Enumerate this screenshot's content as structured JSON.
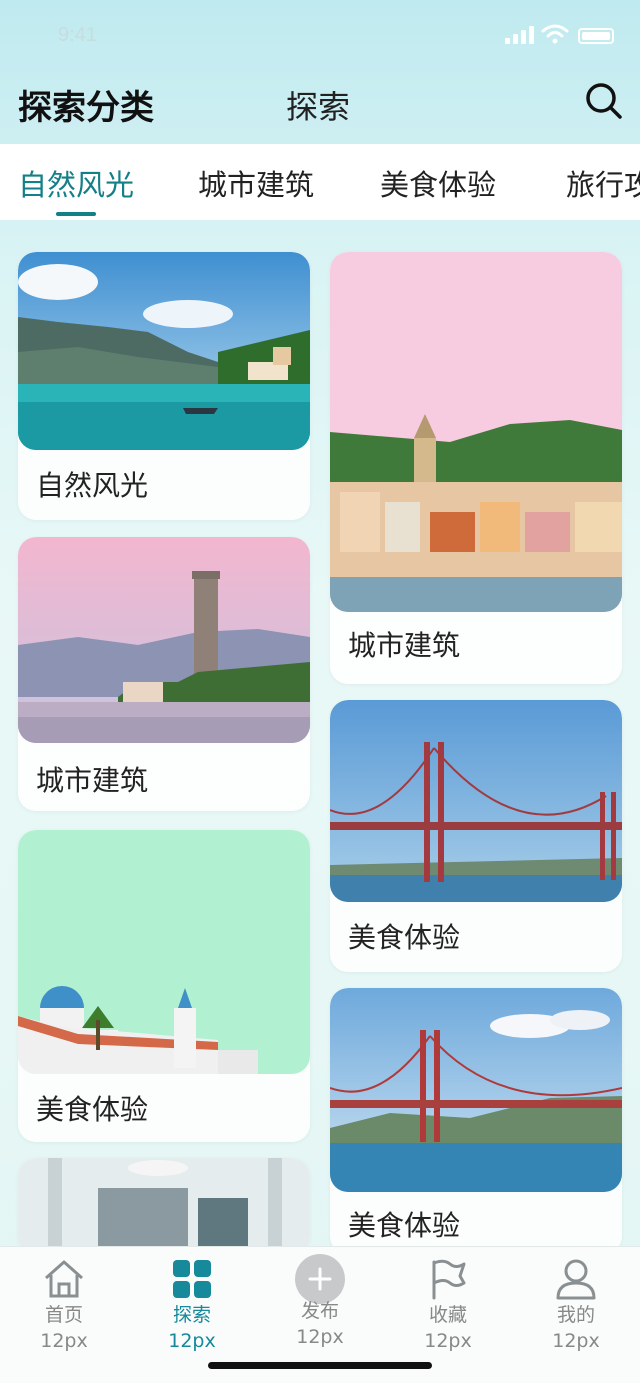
{
  "status_bar": {
    "time": "9:41"
  },
  "header": {
    "title": "探索分类",
    "subtitle": "探索"
  },
  "tabs": [
    {
      "label": "自然风光",
      "active": true
    },
    {
      "label": "城市建筑",
      "active": false
    },
    {
      "label": "美食体验",
      "active": false
    },
    {
      "label": "旅行攻略",
      "active": false
    }
  ],
  "cards": [
    {
      "label": "自然风光",
      "image": "seaside-village-with-boat"
    },
    {
      "label": "城市建筑",
      "image": "colorful-harbor-town-with-bell-tower"
    },
    {
      "label": "城市建筑",
      "image": "stone-tower-by-lake-at-dusk"
    },
    {
      "label": "美食体验",
      "image": "suspension-bridge-blue-sky"
    },
    {
      "label": "美食体验",
      "image": "white-church-with-blue-dome"
    },
    {
      "label": "美食体验",
      "image": "suspension-bridge-over-bay"
    },
    {
      "label": "",
      "image": "interior-hall-with-chandelier"
    }
  ],
  "bottom_nav": [
    {
      "label": "首页",
      "size": "12px",
      "icon": "home-icon",
      "active": false
    },
    {
      "label": "探索",
      "size": "12px",
      "icon": "grid-icon",
      "active": true
    },
    {
      "label": "发布",
      "size": "12px",
      "icon": "plus-circle-icon",
      "active": false
    },
    {
      "label": "收藏",
      "size": "12px",
      "icon": "flag-icon",
      "active": false
    },
    {
      "label": "我的",
      "size": "12px",
      "icon": "user-icon",
      "active": false
    }
  ],
  "colors": {
    "accent": "#137f86",
    "nav_active": "#16899a",
    "nav_inactive": "#888888"
  }
}
